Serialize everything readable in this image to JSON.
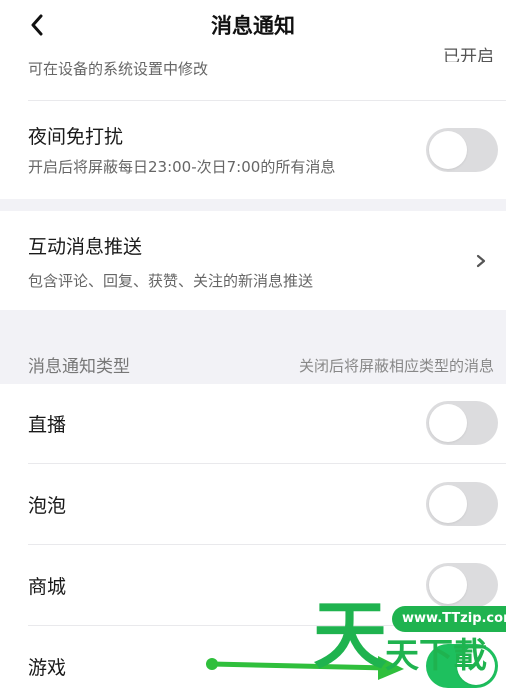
{
  "header": {
    "title": "消息通知",
    "back_icon": "chevron-left-icon"
  },
  "top_row": {
    "subtitle": "可在设备的系统设置中修改",
    "status_partial": "已开启"
  },
  "night_mode": {
    "title": "夜间免打扰",
    "subtitle": "开启后将屏蔽每日23:00-次日7:00的所有消息",
    "enabled": false
  },
  "interaction_push": {
    "title": "互动消息推送",
    "subtitle": "包含评论、回复、获赞、关注的新消息推送",
    "icon": "chevron-right-icon"
  },
  "types_section": {
    "label": "消息通知类型",
    "hint": "关闭后将屏蔽相应类型的消息",
    "items": [
      {
        "label": "直播",
        "enabled": false
      },
      {
        "label": "泡泡",
        "enabled": false
      },
      {
        "label": "商城",
        "enabled": false
      },
      {
        "label": "游戏",
        "enabled": true
      }
    ]
  },
  "watermark": {
    "url": "www.TTzip.com",
    "big_char": "天",
    "small_text": "天下載"
  },
  "colors": {
    "toggle_off": "#dcdcde",
    "toggle_on": "#1ec05e",
    "watermark_green": "#1fb34f",
    "section_bg": "#f2f2f6"
  }
}
